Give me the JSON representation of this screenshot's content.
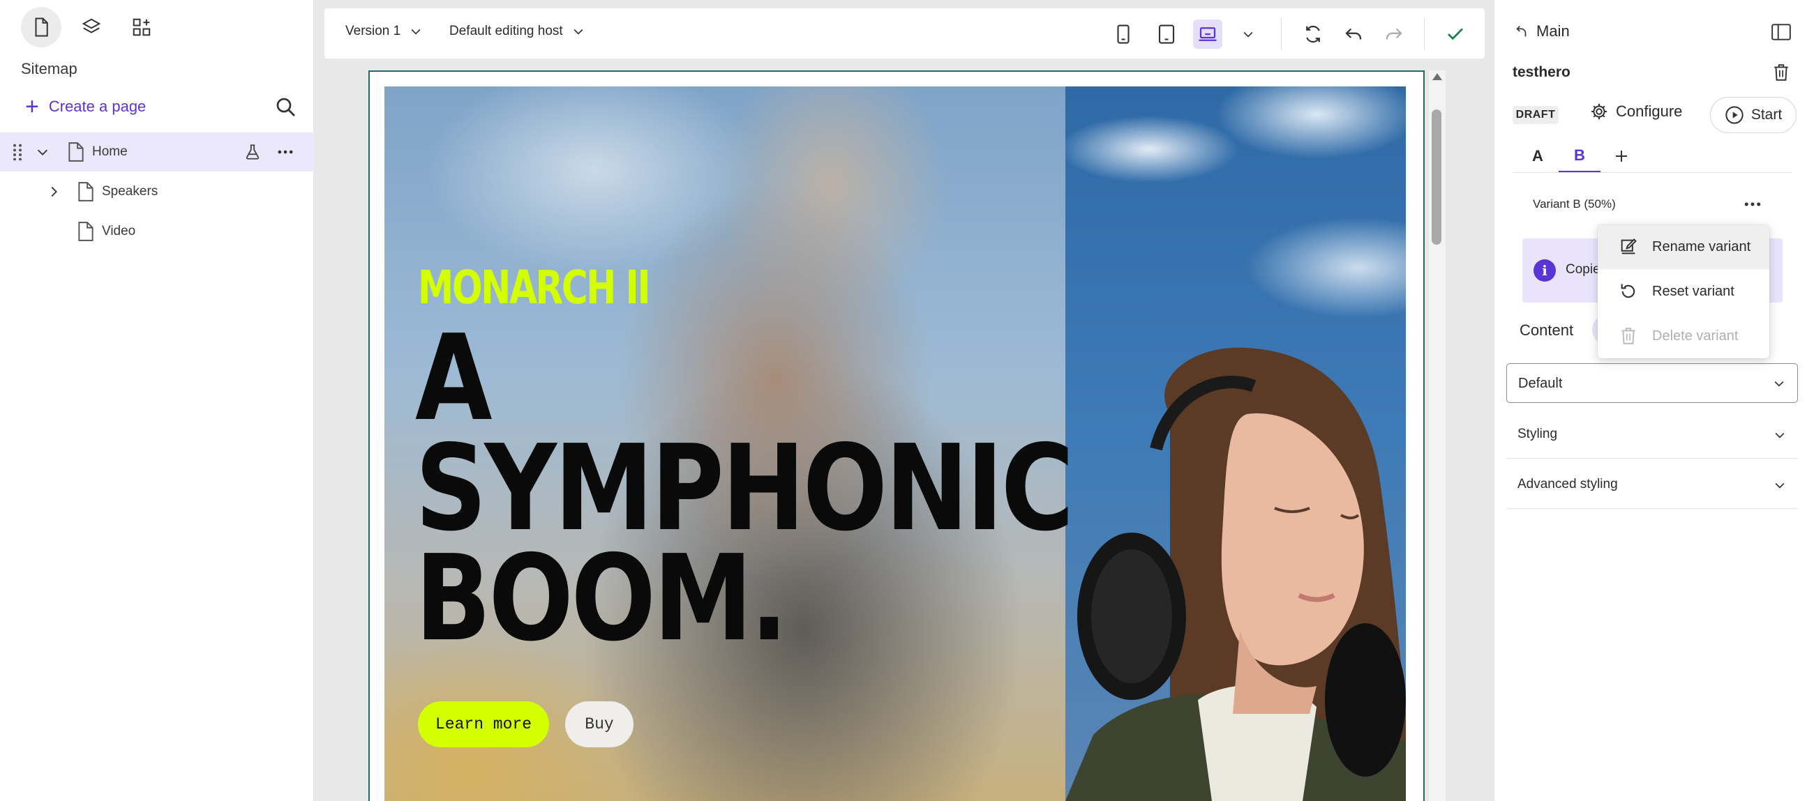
{
  "sidebar": {
    "title": "Sitemap",
    "create_page_label": "Create a page",
    "tree": [
      {
        "label": "Home",
        "expanded": true,
        "selected": true
      },
      {
        "label": "Speakers",
        "expanded": false
      },
      {
        "label": "Video"
      }
    ]
  },
  "toolbar": {
    "version_label": "Version 1",
    "host_label": "Default editing host",
    "active_device": "desktop"
  },
  "hero": {
    "eyebrow": "MONARCH II",
    "title_lines": [
      "A",
      "SYMPHONIC",
      "BOOM."
    ],
    "learn_more_label": "Learn more",
    "buy_label": "Buy",
    "accent_color": "#d4ff00"
  },
  "inspector": {
    "back_label": "Main",
    "component_name": "testhero",
    "status_badge": "DRAFT",
    "configure_label": "Configure",
    "start_label": "Start",
    "variant_tabs": [
      "A",
      "B"
    ],
    "active_variant_tab": "B",
    "variant_label": "Variant B  (50%)",
    "info_text": "Copie",
    "content_label": "Content",
    "data_source_value": "Default",
    "sections": [
      "Styling",
      "Advanced styling"
    ]
  },
  "variant_menu": {
    "items": [
      {
        "label": "Rename variant",
        "icon": "rename-icon",
        "state": "hover"
      },
      {
        "label": "Reset variant",
        "icon": "reset-icon",
        "state": "normal"
      },
      {
        "label": "Delete variant",
        "icon": "trash-icon",
        "state": "disabled"
      }
    ]
  },
  "colors": {
    "brand_purple": "#5a35d6",
    "selected_row_bg": "#ebe8fb",
    "frame_border": "#1f6a71",
    "check_green": "#1a7f4e"
  }
}
